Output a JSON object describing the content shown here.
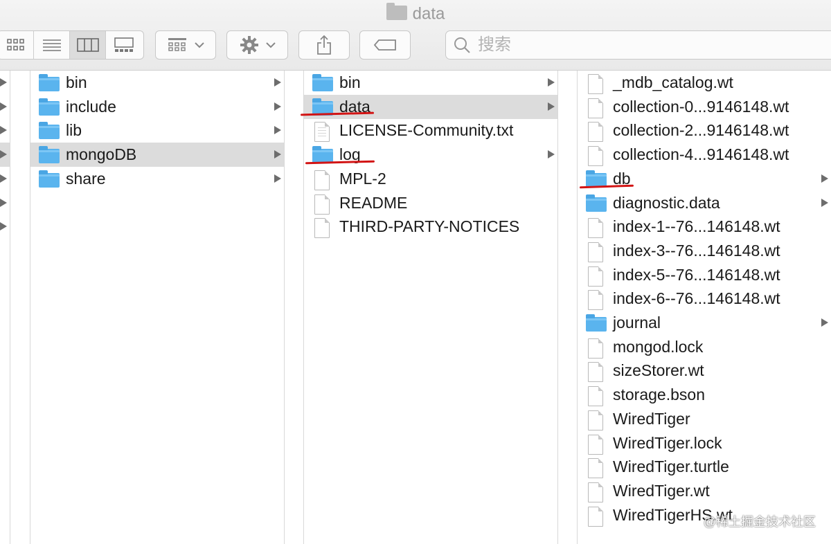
{
  "window": {
    "title": "data"
  },
  "toolbar": {
    "view_modes": [
      "icon-view-icon",
      "list-view-icon",
      "column-view-icon",
      "gallery-view-icon"
    ],
    "selected_view": "column-view-icon",
    "search": {
      "placeholder": "搜索"
    }
  },
  "column2": {
    "items": [
      {
        "name": "bin",
        "type": "folder"
      },
      {
        "name": "include",
        "type": "folder"
      },
      {
        "name": "lib",
        "type": "folder"
      },
      {
        "name": "mongoDB",
        "type": "folder",
        "selected": true
      },
      {
        "name": "share",
        "type": "folder"
      }
    ]
  },
  "column3": {
    "items": [
      {
        "name": "bin",
        "type": "folder"
      },
      {
        "name": "data",
        "type": "folder",
        "selected": true
      },
      {
        "name": "LICENSE-Community.txt",
        "type": "text-file"
      },
      {
        "name": "log",
        "type": "folder"
      },
      {
        "name": "MPL-2",
        "type": "file"
      },
      {
        "name": "README",
        "type": "file"
      },
      {
        "name": "THIRD-PARTY-NOTICES",
        "type": "file"
      }
    ]
  },
  "column4": {
    "items": [
      {
        "name": "_mdb_catalog.wt",
        "type": "file"
      },
      {
        "name": "collection-0...9146148.wt",
        "type": "file"
      },
      {
        "name": "collection-2...9146148.wt",
        "type": "file"
      },
      {
        "name": "collection-4...9146148.wt",
        "type": "file"
      },
      {
        "name": "db",
        "type": "folder"
      },
      {
        "name": "diagnostic.data",
        "type": "folder"
      },
      {
        "name": "index-1--76...146148.wt",
        "type": "file"
      },
      {
        "name": "index-3--76...146148.wt",
        "type": "file"
      },
      {
        "name": "index-5--76...146148.wt",
        "type": "file"
      },
      {
        "name": "index-6--76...146148.wt",
        "type": "file"
      },
      {
        "name": "journal",
        "type": "folder"
      },
      {
        "name": "mongod.lock",
        "type": "file"
      },
      {
        "name": "sizeStorer.wt",
        "type": "file"
      },
      {
        "name": "storage.bson",
        "type": "file"
      },
      {
        "name": "WiredTiger",
        "type": "file"
      },
      {
        "name": "WiredTiger.lock",
        "type": "file"
      },
      {
        "name": "WiredTiger.turtle",
        "type": "file"
      },
      {
        "name": "WiredTiger.wt",
        "type": "file"
      },
      {
        "name": "WiredTigerHS.wt",
        "type": "file"
      }
    ]
  },
  "annotations": {
    "underlines": [
      "data",
      "log",
      "db"
    ],
    "color": "#d21414"
  },
  "watermark": "@稀土掘金技术社区",
  "colors": {
    "folder": "#5ab4ee",
    "selection": "#dcdcdc"
  }
}
